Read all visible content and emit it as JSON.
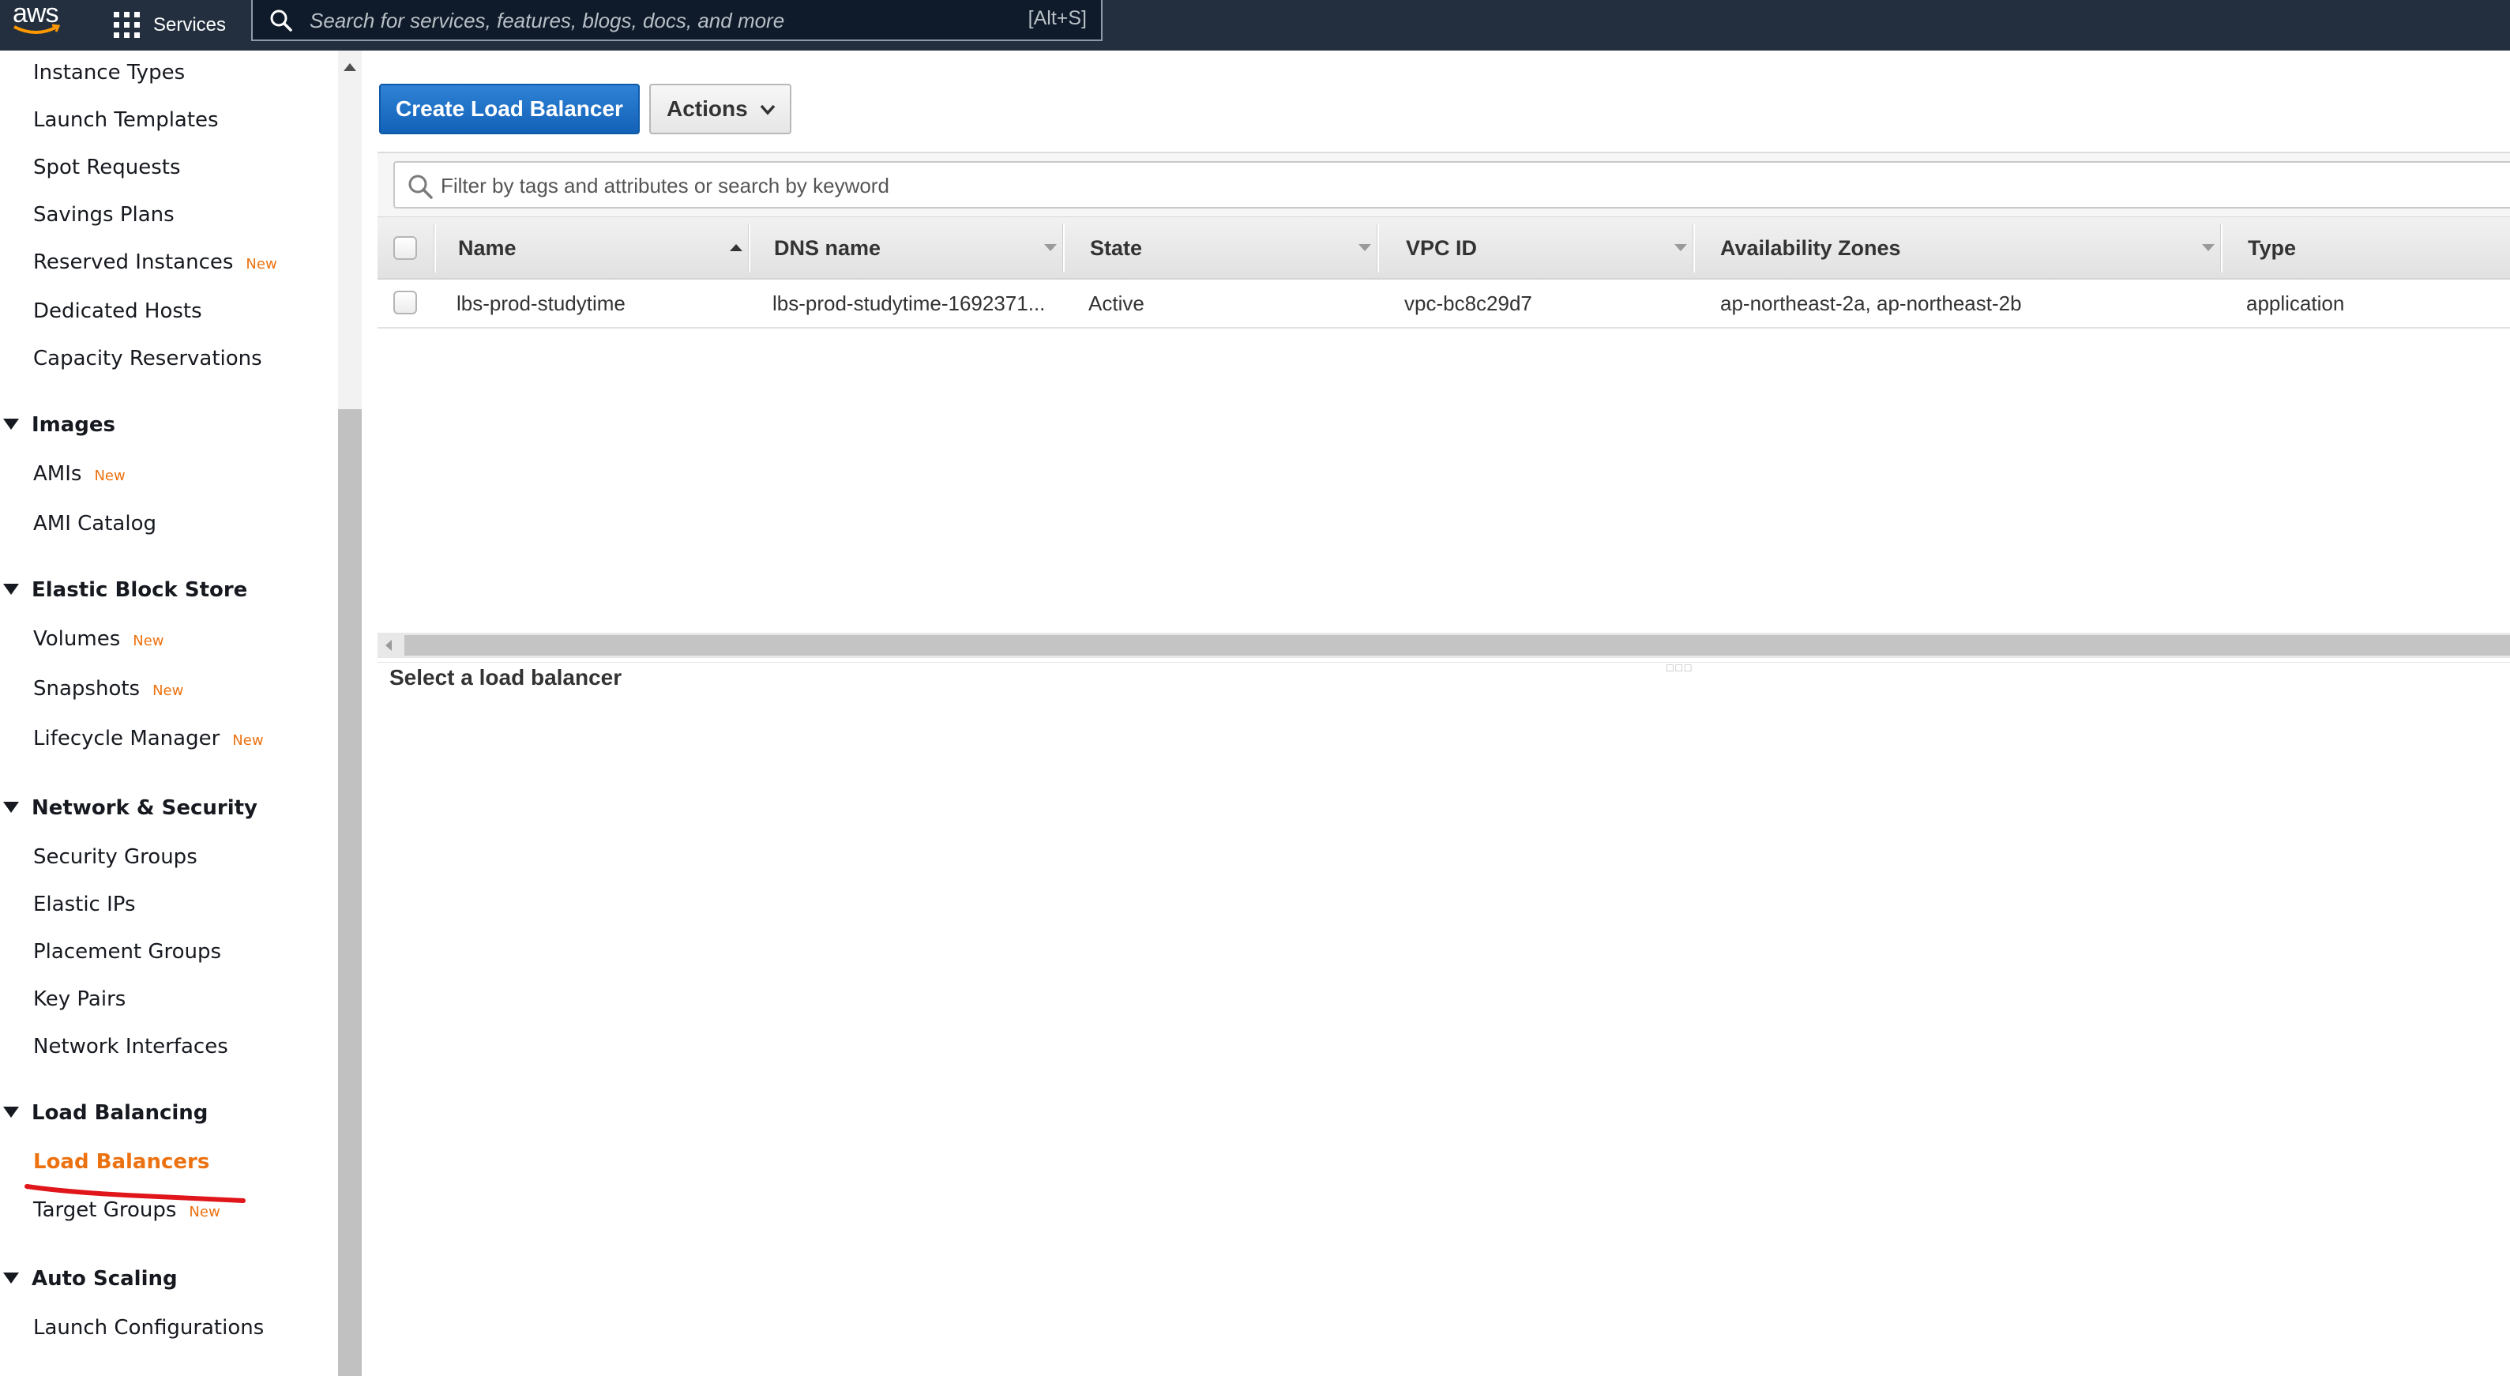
{
  "topbar": {
    "logo_text": "aws",
    "services_label": "Services",
    "search_placeholder": "Search for services, features, blogs, docs, and more",
    "search_shortcut": "[Alt+S]"
  },
  "sidebar": {
    "new_badge": "New",
    "items": [
      {
        "label": "Instance Types"
      },
      {
        "label": "Launch Templates"
      },
      {
        "label": "Spot Requests"
      },
      {
        "label": "Savings Plans"
      },
      {
        "label": "Reserved Instances",
        "badge": "New"
      },
      {
        "label": "Dedicated Hosts"
      },
      {
        "label": "Capacity Reservations"
      }
    ],
    "sections": [
      {
        "title": "Images",
        "items": [
          {
            "label": "AMIs",
            "badge": "New"
          },
          {
            "label": "AMI Catalog"
          }
        ]
      },
      {
        "title": "Elastic Block Store",
        "items": [
          {
            "label": "Volumes",
            "badge": "New"
          },
          {
            "label": "Snapshots",
            "badge": "New"
          },
          {
            "label": "Lifecycle Manager",
            "badge": "New"
          }
        ]
      },
      {
        "title": "Network & Security",
        "items": [
          {
            "label": "Security Groups"
          },
          {
            "label": "Elastic IPs"
          },
          {
            "label": "Placement Groups"
          },
          {
            "label": "Key Pairs"
          },
          {
            "label": "Network Interfaces"
          }
        ]
      },
      {
        "title": "Load Balancing",
        "items": [
          {
            "label": "Load Balancers",
            "active": true
          },
          {
            "label": "Target Groups",
            "badge": "New"
          }
        ]
      },
      {
        "title": "Auto Scaling",
        "items": [
          {
            "label": "Launch Configurations"
          }
        ]
      }
    ],
    "annotation_color": "#e0161b"
  },
  "main": {
    "create_button": "Create Load Balancer",
    "actions_button": "Actions",
    "filter_placeholder": "Filter by tags and attributes or search by keyword",
    "columns": [
      "Name",
      "DNS name",
      "State",
      "VPC ID",
      "Availability Zones",
      "Type"
    ],
    "rows": [
      {
        "name": "lbs-prod-studytime",
        "dns_name": "lbs-prod-studytime-1692371...",
        "state": "Active",
        "vpc_id": "vpc-bc8c29d7",
        "availability_zones": "ap-northeast-2a, ap-northeast-2b",
        "type": "application"
      }
    ],
    "detail_title": "Select a load balancer"
  },
  "colors": {
    "topbar_bg": "#232f3e",
    "accent_orange": "#ec7211",
    "primary_blue": "#1a6fc9"
  }
}
